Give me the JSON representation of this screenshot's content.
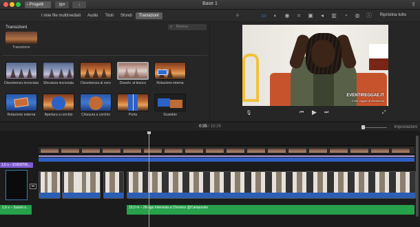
{
  "titlebar": {
    "back_label": "‹ Progetti",
    "window_title": "Base 1"
  },
  "toolbar": {
    "tabs": [
      "I miei file multimediali",
      "Audio",
      "Titoli",
      "Sfondi",
      "Transizioni"
    ],
    "active_tab": "Transizioni",
    "reset_label": "Ripristina tutto"
  },
  "browser": {
    "title": "Transizioni",
    "search_placeholder": "Ricerca",
    "first_item_label": "Transizione",
    "items": [
      {
        "label": "Dissolvenza incrociata",
        "scene": "scene-a"
      },
      {
        "label": "Sfocatura incrociata",
        "scene": "scene-a"
      },
      {
        "label": "Dissolvenza al nero",
        "scene": "scene-b"
      },
      {
        "label": "Dissolv. al bianco",
        "scene": "scene-w",
        "selected": true
      },
      {
        "label": "Rotazione interna",
        "scene": "scene-b"
      },
      {
        "label": "Rotazione esterna",
        "scene": "scene-c"
      },
      {
        "label": "Apertura a cerchio",
        "scene": "scene-b"
      },
      {
        "label": "Chiusura a cerchio",
        "scene": "scene-b"
      },
      {
        "label": "Porta",
        "scene": "scene-b"
      },
      {
        "label": "Scambio",
        "scene": "scene-c"
      }
    ]
  },
  "viewer": {
    "watermark": "EVENTIREGGAE.IT",
    "watermark_sub": "il sito reggae di riferimento"
  },
  "timeline": {
    "current_time": "0:35",
    "total_time": "10:29",
    "settings_label": "Impostazioni",
    "title_clip_label": "1,6 s – EVENTIR...",
    "audio_clip_label": "1,6 s – Suono s...",
    "green_clip_label": "10,0 m – 26-ago Intervista a Chronixx @Campovolo"
  },
  "colors": {
    "accent_blue": "#3a8cff",
    "audio_green": "#27a04b",
    "title_purple": "#7d5bd0",
    "video_blue": "#2f5fc2"
  }
}
